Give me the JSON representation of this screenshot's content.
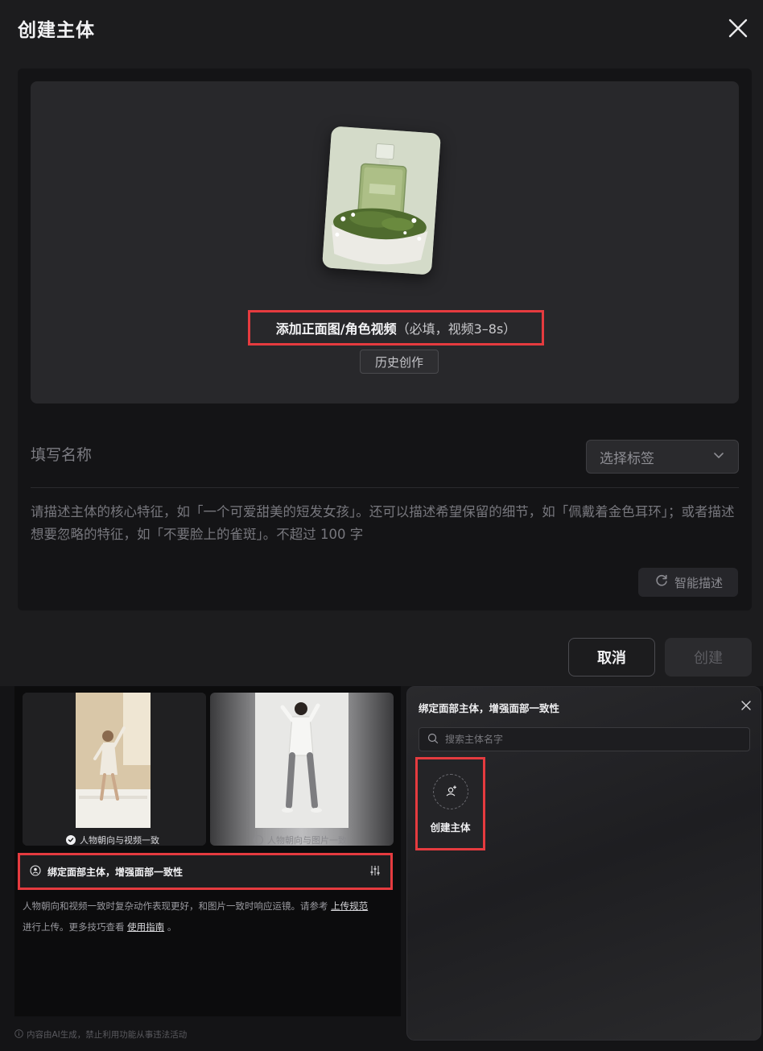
{
  "dialog": {
    "title": "创建主体",
    "upload": {
      "main_label": "添加正面图/角色视频",
      "sub_label": "（必填，视频3–8s）",
      "history_button": "历史创作"
    },
    "name_placeholder": "填写名称",
    "tag_select": {
      "label": "选择标签"
    },
    "description_placeholder": "请描述主体的核心特征，如「一个可爱甜美的短发女孩」。还可以描述希望保留的细节，如「佩戴着金色耳环」；或者描述想要忽略的特征，如「不要脸上的雀斑」。不超过 100 字",
    "smart_describe_button": "智能描述",
    "cancel_button": "取消",
    "create_button": "创建"
  },
  "options": {
    "option1": {
      "caption": "人物朝向与视频一致",
      "selected": true
    },
    "option2": {
      "caption": "人物朝向与图片一致",
      "selected": false
    },
    "bind_row_label": "绑定面部主体，增强面部一致性",
    "hint_part1": "人物朝向和视频一致时复杂动作表现更好，和图片一致时响应运镜。请参考",
    "hint_link1": "上传规范",
    "hint_part2": "进行上传。更多技巧查看",
    "hint_link2": "使用指南",
    "hint_part3": "。",
    "footnote": "内容由AI生成，禁止利用功能从事违法活动"
  },
  "subject_panel": {
    "title": "绑定面部主体，增强面部一致性",
    "search_placeholder": "搜索主体名字",
    "create_card_label": "创建主体"
  },
  "colors": {
    "highlight_border": "#e53b3f",
    "background": "#1c1c1e",
    "panel": "#141416"
  }
}
